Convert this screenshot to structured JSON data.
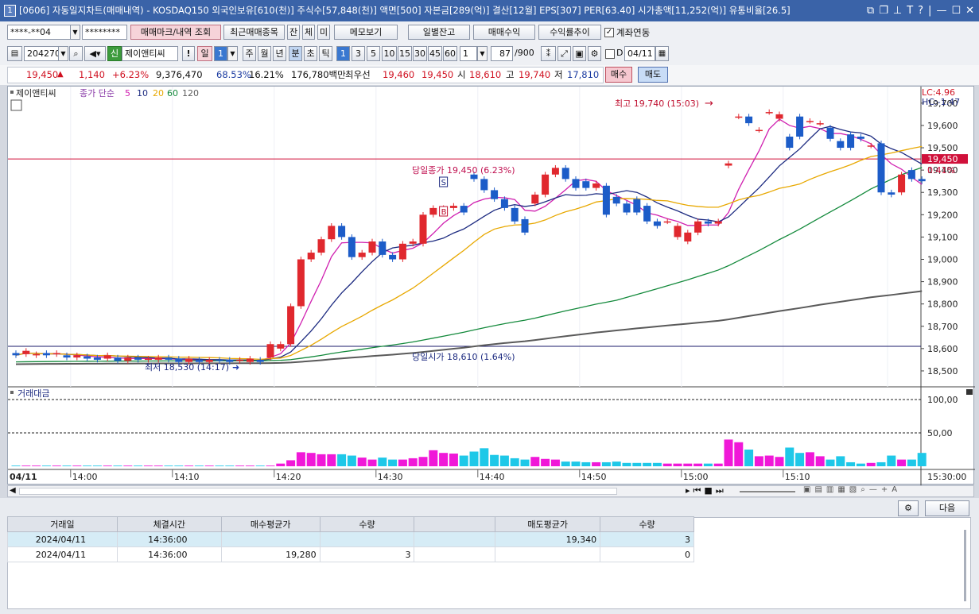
{
  "window": {
    "title": "[0606] 자동일지차트(매매내역) - KOSDAQ150 외국인보유[610(천)] 주식수[57,848(천)] 액면[500] 자본금[289(억)] 결산[12월] EPS[307] PER[63.40] 시가총액[11,252(억)] 유통비율[26.5]",
    "app_icon": "1"
  },
  "toolbar1": {
    "account": "****-**04",
    "password": "********",
    "mark_button": "매매마크/내역 조회",
    "recent_button": "최근매매종목",
    "tab_jan": "잔",
    "tab_che": "체",
    "tab_mi": "미",
    "memo_button": "메모보기",
    "daily_balance_button": "일별잔고",
    "profit_button": "매매수익",
    "return_button": "수익률추이",
    "account_link_label": "계좌연동"
  },
  "toolbar2": {
    "code": "204270",
    "name_badge": "신",
    "name": "제이앤티씨",
    "period_day": "일",
    "period_day_num": "1",
    "periods": [
      "주",
      "월",
      "년",
      "분",
      "초",
      "틱"
    ],
    "minutes": [
      "1",
      "3",
      "5",
      "10",
      "15",
      "30",
      "45",
      "60"
    ],
    "interval_value": "1",
    "count": "87",
    "count_total": "/900",
    "date_d": "D",
    "date": "04/11"
  },
  "quote": {
    "price": "19,450",
    "direction_arrow": "▲",
    "change": "1,140",
    "change_pct": "+6.23%",
    "volume": "9,376,470",
    "ratio1": "68.53%",
    "ratio2": "16.21%",
    "amount": "176,780백만",
    "best_label": "최우선",
    "best_bid": "19,460",
    "best_ask": "19,450",
    "open_label": "시",
    "open": "18,610",
    "high_label": "고",
    "high": "19,740",
    "low_label": "저",
    "low": "17,810",
    "buy_button": "매수",
    "sell_button": "매도"
  },
  "chart": {
    "stock_label": "제이앤티씨",
    "ma_title": "종가 단순",
    "ma_periods": [
      "5",
      "10",
      "20",
      "60",
      "120"
    ],
    "ma_colors": [
      "#d020b0",
      "#1c2a80",
      "#e8a800",
      "#148a3c",
      "#5a5a5a"
    ],
    "lc": "LC:4.96",
    "hc": "HC:-1.47",
    "high_annot": "최고 19,740 (15:03)",
    "close_annot": "당일종가 19,450 (6.23%)",
    "open_annot": "당일시가 18,610 (1.64%)",
    "low_annot": "최저 18,530 (14:17)",
    "price_tag": "19,450",
    "pct_tag": "0.41%",
    "s_mark": "S",
    "b_mark": "B",
    "volume_label": "거래대금",
    "date_label": "04/11",
    "right_time": "15:30:00"
  },
  "chart_data": {
    "type": "candlestick",
    "y_axis_ticks": [
      19700,
      19600,
      19500,
      19400,
      19300,
      19200,
      19100,
      19000,
      18900,
      18800,
      18700,
      18600,
      18500
    ],
    "x_ticks": [
      "14:00",
      "14:10",
      "14:20",
      "14:30",
      "14:40",
      "14:50",
      "15:00",
      "15:10"
    ],
    "volume_ticks": [
      "100,00",
      "50,00"
    ],
    "ylim": [
      18450,
      19760
    ],
    "reference_lines": {
      "close": 19450,
      "open": 18610
    },
    "candles_open": [
      18580,
      18575,
      18570,
      18580,
      18575,
      18570,
      18560,
      18565,
      18560,
      18555,
      18560,
      18545,
      18560,
      18550,
      18550,
      18560,
      18555,
      18540,
      18550,
      18540,
      18550,
      18550,
      18545,
      18540,
      18550,
      18560,
      18600,
      18620,
      18790,
      19000,
      19030,
      19090,
      19150,
      19100,
      19010,
      19030,
      19080,
      19020,
      19000,
      19070,
      19070,
      19200,
      19230,
      19230,
      19240,
      19380,
      19360,
      19310,
      19270,
      19230,
      19180,
      19250,
      19290,
      19380,
      19410,
      19360,
      19350,
      19320,
      19330,
      19280,
      19250,
      19270,
      19240,
      19170,
      19170,
      19100,
      19080,
      19120,
      19170,
      19160,
      19420,
      19640,
      19640,
      19580,
      19660,
      19630,
      19550,
      19640,
      19620,
      19610,
      19590,
      19530,
      19560,
      19550,
      19510,
      19520,
      19300,
      19300,
      19400,
      19360
    ],
    "candles_close": [
      18570,
      18590,
      18575,
      18570,
      18580,
      18560,
      18570,
      18555,
      18550,
      18570,
      18545,
      18560,
      18550,
      18555,
      18560,
      18550,
      18540,
      18555,
      18540,
      18550,
      18545,
      18540,
      18550,
      18555,
      18540,
      18620,
      18620,
      18790,
      19000,
      19030,
      19090,
      19150,
      19100,
      19010,
      19030,
      19080,
      19020,
      19000,
      19070,
      19080,
      19200,
      19230,
      19230,
      19240,
      19210,
      19360,
      19310,
      19270,
      19230,
      19170,
      19120,
      19290,
      19380,
      19410,
      19360,
      19320,
      19320,
      19340,
      19200,
      19250,
      19210,
      19210,
      19170,
      19150,
      19170,
      19150,
      19120,
      19170,
      19160,
      19170,
      19430,
      19640,
      19610,
      19580,
      19660,
      19650,
      19500,
      19550,
      19620,
      19610,
      19540,
      19500,
      19500,
      19540,
      19510,
      19300,
      19290,
      19380,
      19360,
      19350
    ],
    "volume": [
      1,
      1,
      1,
      1,
      1,
      1,
      1,
      1,
      1,
      1,
      1,
      1,
      1,
      1,
      1,
      1,
      1,
      1,
      1,
      1,
      1,
      1,
      1,
      1,
      1,
      1,
      4,
      9,
      21,
      20,
      18,
      18,
      18,
      16,
      13,
      10,
      13,
      10,
      10,
      12,
      14,
      24,
      20,
      19,
      16,
      22,
      27,
      17,
      16,
      12,
      10,
      14,
      11,
      10,
      7,
      7,
      6,
      6,
      6,
      7,
      5,
      5,
      5,
      5,
      4,
      4,
      4,
      4,
      4,
      4,
      40,
      36,
      25,
      15,
      16,
      14,
      28,
      20,
      21,
      15,
      10,
      15,
      6,
      4,
      5,
      6,
      16,
      10,
      10,
      20
    ],
    "ma": {
      "5": [],
      "10": [],
      "20": [],
      "60": [],
      "120": []
    }
  },
  "bottom": {
    "settings_icon": "gear-icon",
    "next_button": "다음",
    "columns": [
      "거래일",
      "체결시간",
      "매수평균가",
      "수량",
      "",
      "매도평균가",
      "수량"
    ],
    "rows": [
      [
        "2024/04/11",
        "14:36:00",
        "",
        "",
        "",
        "19,340",
        "3"
      ],
      [
        "2024/04/11",
        "14:36:00",
        "19,280",
        "3",
        "",
        "",
        "0"
      ]
    ]
  }
}
